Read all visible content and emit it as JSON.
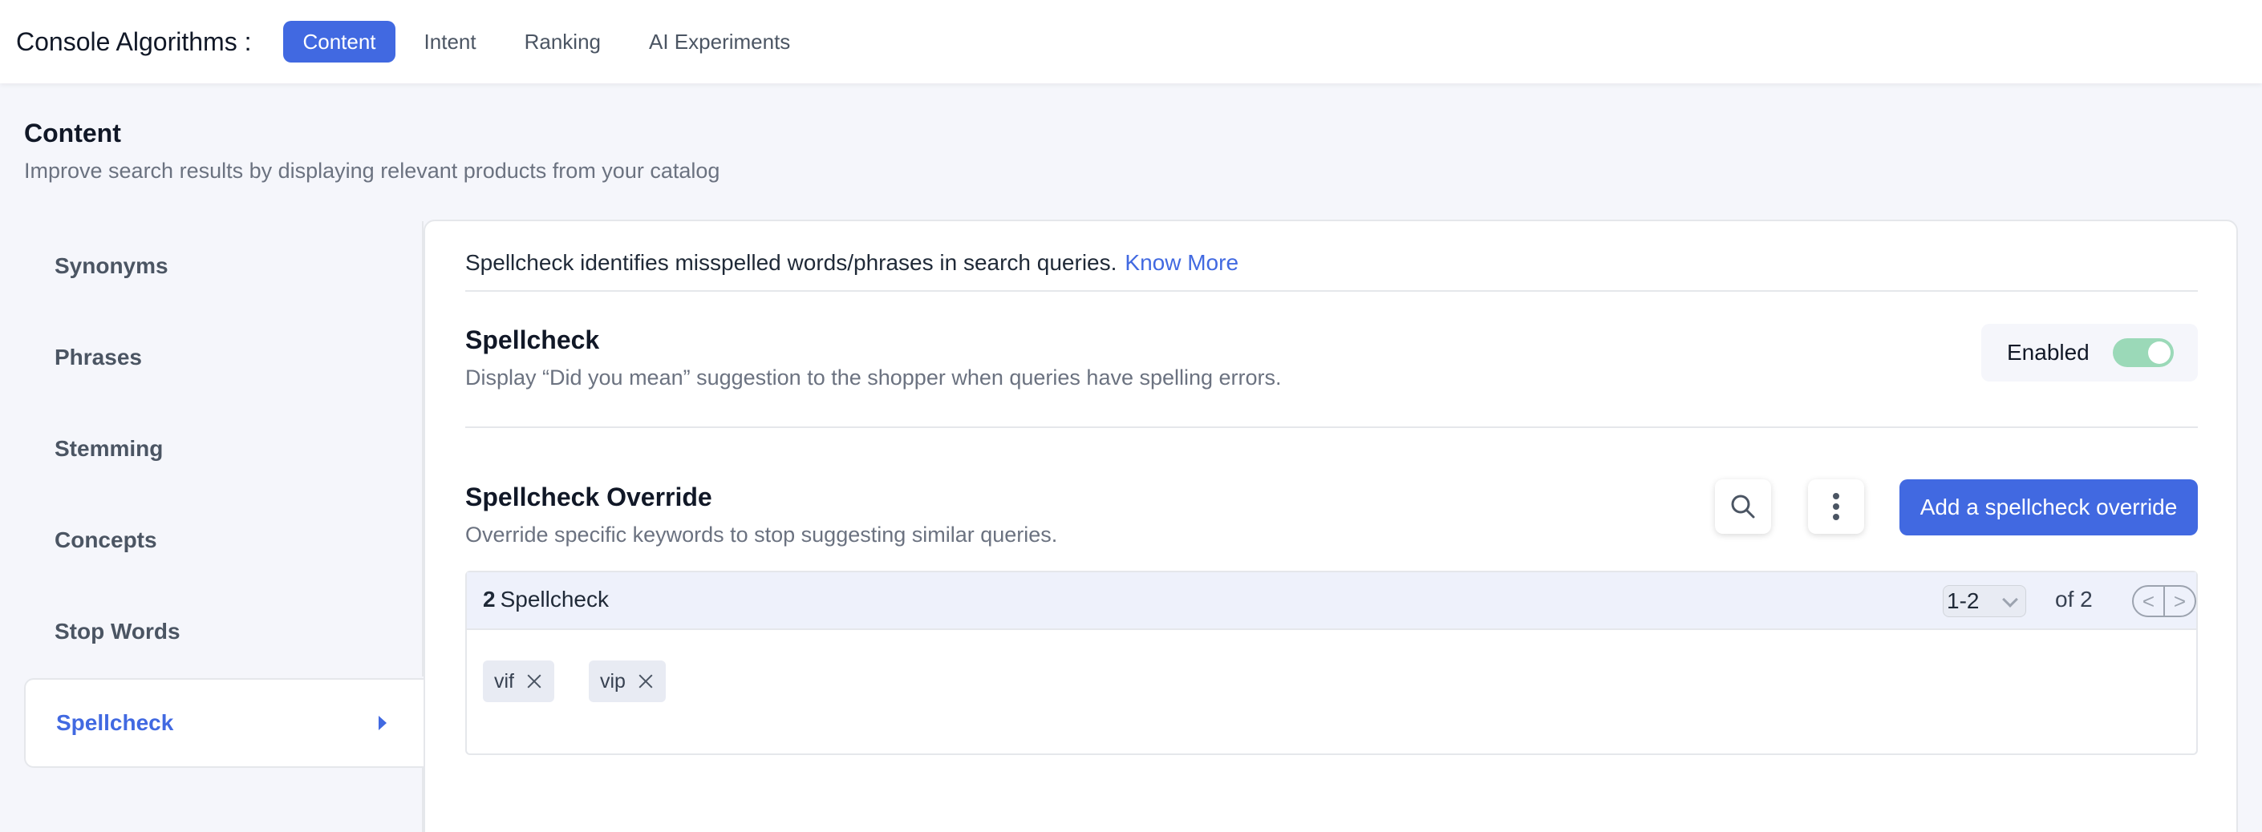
{
  "app": {
    "title": "Console Algorithms :"
  },
  "tabs": [
    {
      "label": "Content",
      "active": true
    },
    {
      "label": "Intent"
    },
    {
      "label": "Ranking"
    },
    {
      "label": "AI Experiments"
    }
  ],
  "page": {
    "title": "Content",
    "subtitle": "Improve search results by displaying relevant products from your catalog"
  },
  "sidebar": {
    "items": [
      {
        "label": "Synonyms"
      },
      {
        "label": "Phrases"
      },
      {
        "label": "Stemming"
      },
      {
        "label": "Concepts"
      },
      {
        "label": "Stop Words"
      },
      {
        "label": "Spellcheck",
        "active": true
      }
    ]
  },
  "main": {
    "intro": "Spellcheck identifies misspelled words/phrases in search queries.",
    "know_more": "Know More",
    "spellcheck": {
      "title": "Spellcheck",
      "description": "Display “Did you mean” suggestion to the shopper when queries have spelling errors.",
      "status_label": "Enabled",
      "enabled": true
    },
    "override": {
      "title": "Spellcheck Override",
      "description": "Override specific keywords to stop suggesting similar queries.",
      "add_button": "Add a spellcheck override",
      "search_icon": "search-icon",
      "more_icon": "more-vertical-icon"
    },
    "table": {
      "count": "2",
      "count_label": "Spellcheck",
      "range": "1-2",
      "of_text": "of 2",
      "prev": "<",
      "next": ">",
      "chips": [
        "vif",
        "vip"
      ]
    }
  },
  "colors": {
    "accent": "#4169e1",
    "toggle_on": "#9bd9b8",
    "background": "#f5f6fb"
  }
}
